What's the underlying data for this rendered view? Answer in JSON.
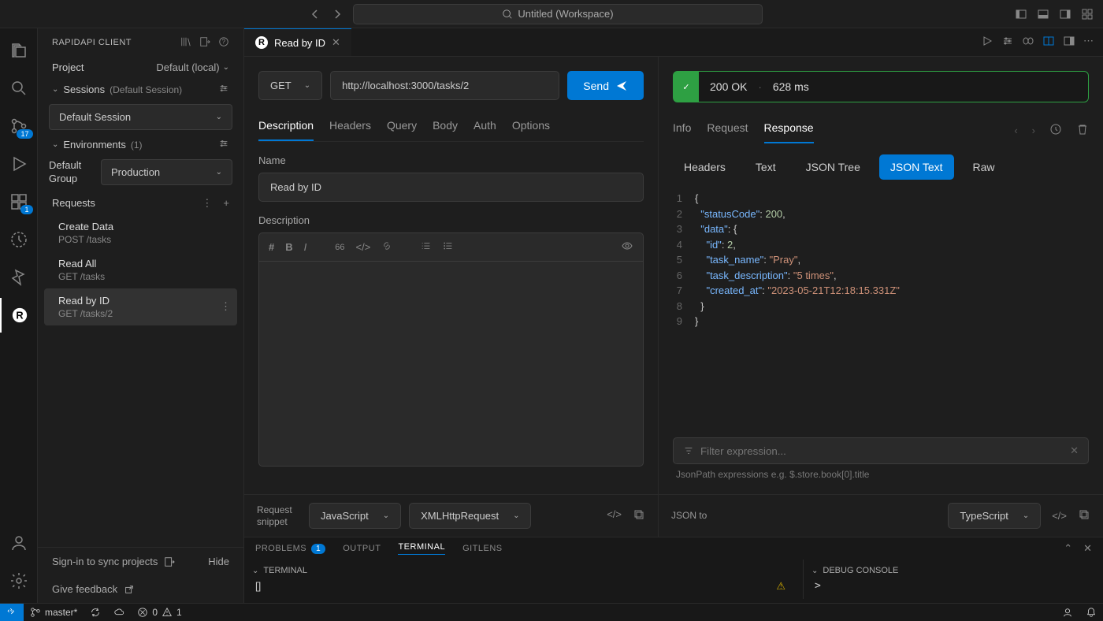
{
  "titlebar": {
    "title": "Untitled (Workspace)"
  },
  "sidebar": {
    "header": "RAPIDAPI CLIENT",
    "project_label": "Project",
    "project_value": "Default (local)",
    "sessions": {
      "title": "Sessions",
      "meta": "(Default Session)",
      "selected": "Default Session"
    },
    "environments": {
      "title": "Environments",
      "meta": "(1)",
      "group_label": "Default Group",
      "selected": "Production"
    },
    "requests_label": "Requests",
    "requests": [
      {
        "name": "Create Data",
        "sub": "POST /tasks"
      },
      {
        "name": "Read All",
        "sub": "GET /tasks"
      },
      {
        "name": "Read by ID",
        "sub": "GET /tasks/2"
      }
    ],
    "signin": "Sign-in to sync projects",
    "hide": "Hide",
    "feedback": "Give feedback"
  },
  "activity_badges": {
    "scm": "17",
    "debug": "1"
  },
  "tab": {
    "title": "Read by ID"
  },
  "request": {
    "method": "GET",
    "url": "http://localhost:3000/tasks/2",
    "send": "Send",
    "tabs": [
      "Description",
      "Headers",
      "Query",
      "Body",
      "Auth",
      "Options"
    ],
    "active_tab": "Description",
    "name_label": "Name",
    "name_value": "Read by ID",
    "desc_label": "Description"
  },
  "response": {
    "status_code": "200 OK",
    "time": "628 ms",
    "nav_tabs": [
      "Info",
      "Request",
      "Response"
    ],
    "active_nav": "Response",
    "view_tabs": [
      "Headers",
      "Text",
      "JSON Tree",
      "JSON Text",
      "Raw"
    ],
    "active_view": "JSON Text",
    "filter_placeholder": "Filter expression...",
    "filter_hint": "JsonPath expressions e.g. $.store.book[0].title",
    "json_lines": [
      {
        "n": "1",
        "indent": 0,
        "tokens": [
          [
            "punc",
            "{"
          ]
        ]
      },
      {
        "n": "2",
        "indent": 1,
        "tokens": [
          [
            "key",
            "\"statusCode\""
          ],
          [
            "punc",
            ": "
          ],
          [
            "num",
            "200"
          ],
          [
            "punc",
            ","
          ]
        ]
      },
      {
        "n": "3",
        "indent": 1,
        "tokens": [
          [
            "key",
            "\"data\""
          ],
          [
            "punc",
            ": {"
          ]
        ]
      },
      {
        "n": "4",
        "indent": 2,
        "tokens": [
          [
            "key",
            "\"id\""
          ],
          [
            "punc",
            ": "
          ],
          [
            "num",
            "2"
          ],
          [
            "punc",
            ","
          ]
        ]
      },
      {
        "n": "5",
        "indent": 2,
        "tokens": [
          [
            "key",
            "\"task_name\""
          ],
          [
            "punc",
            ": "
          ],
          [
            "str",
            "\"Pray\""
          ],
          [
            "punc",
            ","
          ]
        ]
      },
      {
        "n": "6",
        "indent": 2,
        "tokens": [
          [
            "key",
            "\"task_description\""
          ],
          [
            "punc",
            ": "
          ],
          [
            "str",
            "\"5 times\""
          ],
          [
            "punc",
            ","
          ]
        ]
      },
      {
        "n": "7",
        "indent": 2,
        "tokens": [
          [
            "key",
            "\"created_at\""
          ],
          [
            "punc",
            ": "
          ],
          [
            "str",
            "\"2023-05-21T12:18:15.331Z\""
          ]
        ]
      },
      {
        "n": "8",
        "indent": 1,
        "tokens": [
          [
            "punc",
            "}"
          ]
        ]
      },
      {
        "n": "9",
        "indent": 0,
        "tokens": [
          [
            "punc",
            "}"
          ]
        ]
      }
    ]
  },
  "snippet": {
    "left_label": "Request snippet",
    "left_lang": "JavaScript",
    "left_lib": "XMLHttpRequest",
    "right_label": "JSON to",
    "right_lang": "TypeScript"
  },
  "terminal": {
    "tabs": {
      "problems": "PROBLEMS",
      "problems_count": "1",
      "output": "OUTPUT",
      "terminal": "TERMINAL",
      "gitlens": "GITLENS"
    },
    "left_title": "TERMINAL",
    "right_title": "DEBUG CONSOLE",
    "prompt": "[]",
    "debug_prompt": ">"
  },
  "statusbar": {
    "branch": "master*",
    "errors": "0",
    "warnings": "1"
  }
}
